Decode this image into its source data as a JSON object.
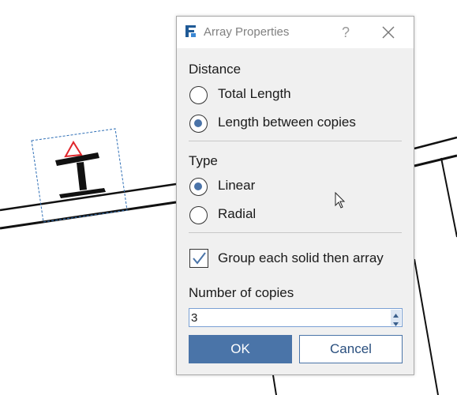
{
  "dialog": {
    "title": "Array Properties",
    "help_label": "?",
    "distance": {
      "label": "Distance",
      "options": [
        {
          "label": "Total Length",
          "selected": false
        },
        {
          "label": "Length between copies",
          "selected": true
        }
      ]
    },
    "type": {
      "label": "Type",
      "options": [
        {
          "label": "Linear",
          "selected": true
        },
        {
          "label": "Radial",
          "selected": false
        }
      ]
    },
    "group_checkbox": {
      "label": "Group each solid then array",
      "checked": true
    },
    "copies": {
      "label": "Number of copies",
      "value": "3"
    },
    "ok_label": "OK",
    "cancel_label": "Cancel"
  },
  "icons": {
    "app": "app-logo-icon",
    "close": "close-icon",
    "spin_up": "spin-up-icon",
    "spin_down": "spin-down-icon",
    "cursor": "mouse-pointer-icon"
  },
  "colors": {
    "accent": "#4a74a8",
    "selection_outline": "#2f6fb6",
    "marker": "#e0262b"
  }
}
